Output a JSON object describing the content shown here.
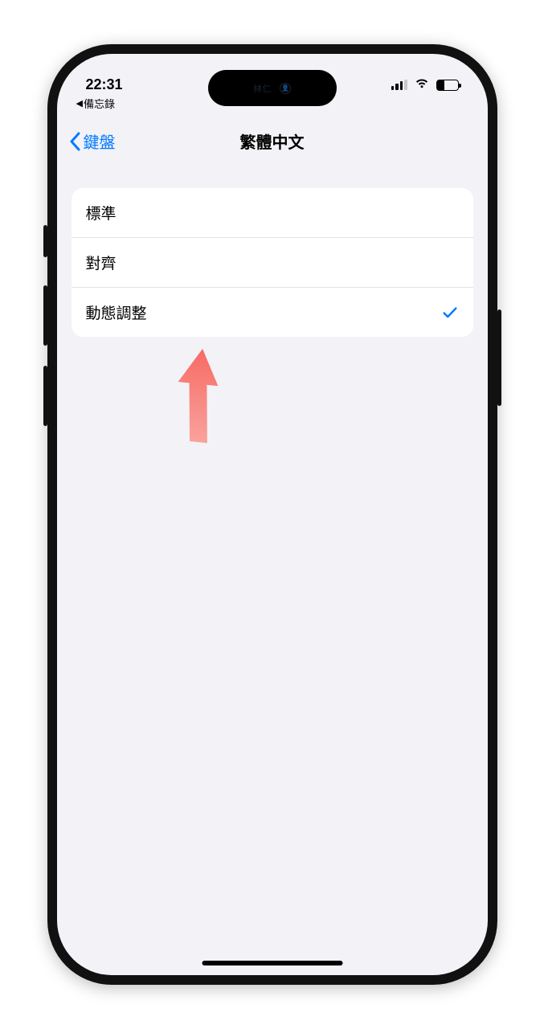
{
  "status": {
    "time": "22:31",
    "breadcrumb": "備忘錄"
  },
  "island": {
    "caption": "林仁"
  },
  "nav": {
    "back_label": "鍵盤",
    "title": "繁體中文"
  },
  "options": [
    {
      "label": "標準",
      "selected": false
    },
    {
      "label": "對齊",
      "selected": false
    },
    {
      "label": "動態調整",
      "selected": true
    }
  ]
}
